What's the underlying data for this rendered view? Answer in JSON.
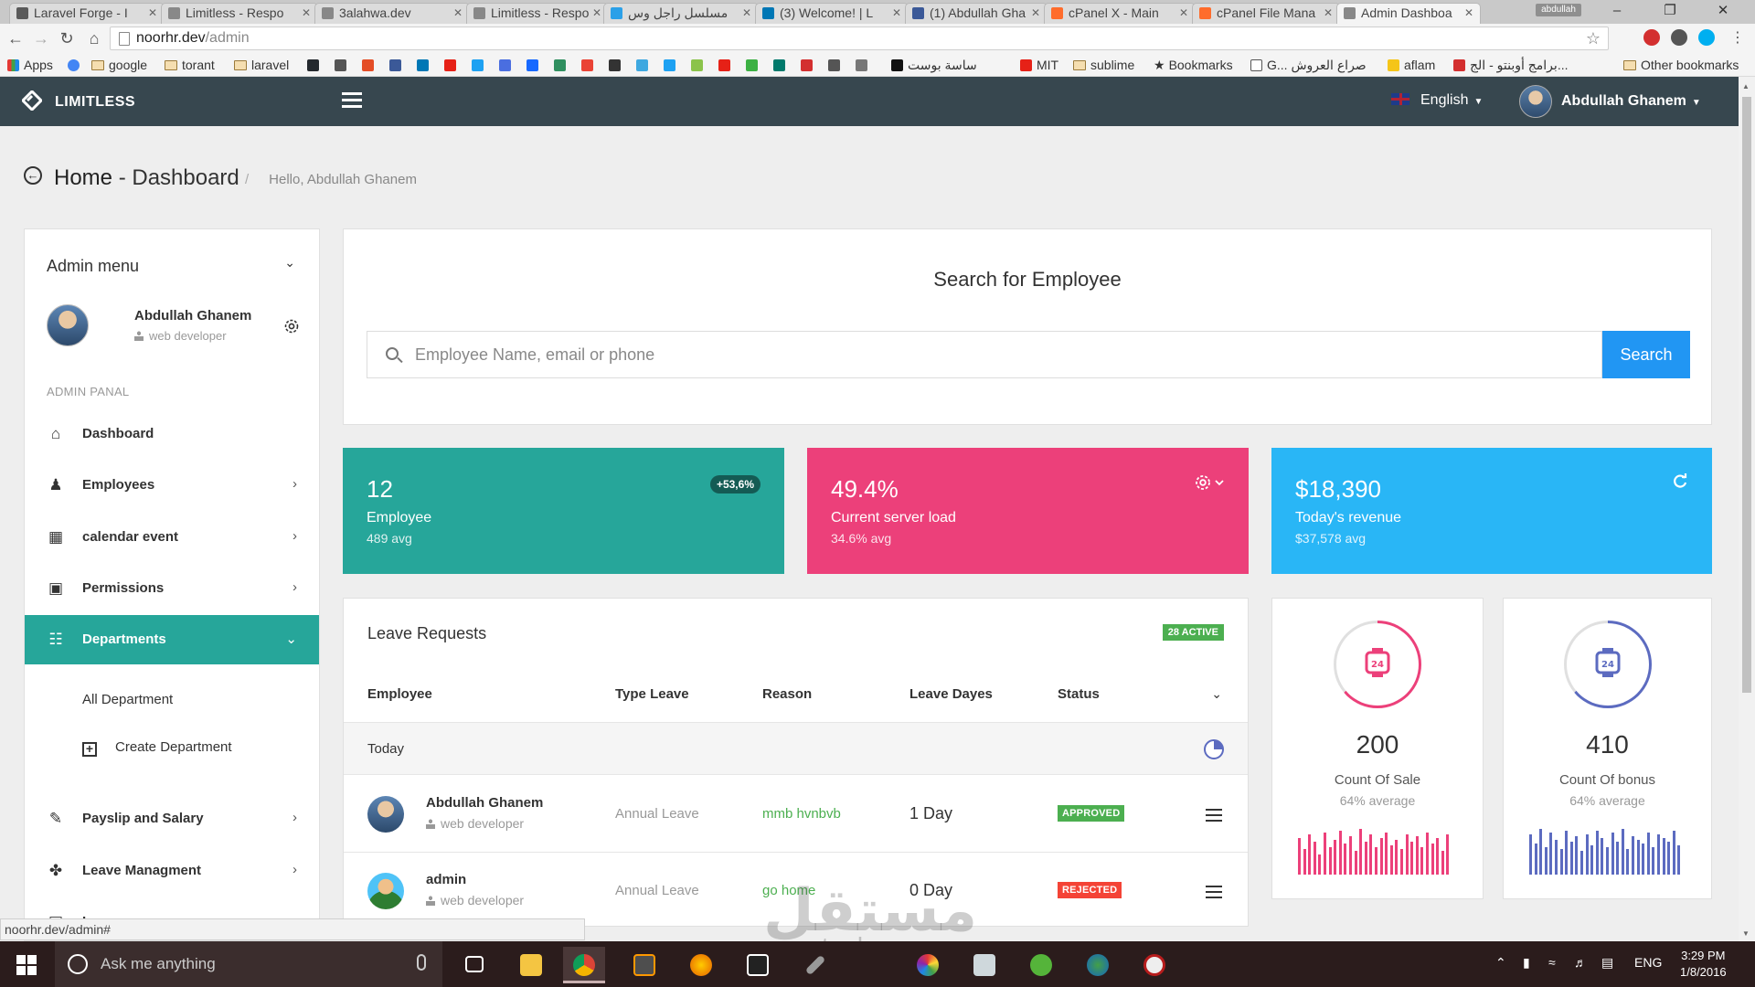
{
  "browser": {
    "tabs": [
      {
        "title": "Laravel Forge - I",
        "favicon_color": "#5a5a5a"
      },
      {
        "title": "Limitless - Respo",
        "favicon_color": "#888888"
      },
      {
        "title": "3alahwa.dev",
        "favicon_color": "#888888"
      },
      {
        "title": "Limitless - Respo",
        "favicon_color": "#888888"
      },
      {
        "title": "مسلسل راجل وس",
        "favicon_color": "#2ba0e8"
      },
      {
        "title": "(3) Welcome! | L",
        "favicon_color": "#0077b5"
      },
      {
        "title": "(1) Abdullah Gha",
        "favicon_color": "#3b5998"
      },
      {
        "title": "cPanel X - Main",
        "favicon_color": "#ff6c2c"
      },
      {
        "title": "cPanel File Mana",
        "favicon_color": "#ff6c2c"
      },
      {
        "title": "Admin Dashboa",
        "favicon_color": "#888888",
        "active": true
      }
    ],
    "profile_chip": "abdullah",
    "url_host": "noorhr.dev",
    "url_path": "/admin",
    "bookmarks": [
      {
        "label": "Apps",
        "kind": "apps"
      },
      {
        "label": "google",
        "kind": "folder"
      },
      {
        "label": "torant",
        "kind": "folder"
      },
      {
        "label": "laravel",
        "kind": "folder"
      },
      {
        "label": "ساسة بوست",
        "kind": "link"
      },
      {
        "label": "MIT",
        "kind": "link"
      },
      {
        "label": "sublime",
        "kind": "folder"
      },
      {
        "label": "Bookmarks",
        "kind": "star"
      },
      {
        "label": "G... صراع العروش",
        "kind": "link"
      },
      {
        "label": "aflam",
        "kind": "link"
      },
      {
        "label": "برامج أوبنتو - الج...",
        "kind": "link"
      },
      {
        "label": "Other bookmarks",
        "kind": "folder"
      }
    ],
    "status_url": "noorhr.dev/admin#"
  },
  "appbar": {
    "brand": "LIMITLESS",
    "language": "English",
    "user_name": "Abdullah Ghanem"
  },
  "page_header": {
    "title_strong": "Home",
    "title_rest": " - Dashboard",
    "greeting": "Hello, Abdullah Ghanem"
  },
  "sidebar": {
    "title": "Admin menu",
    "user_name": "Abdullah Ghanem",
    "user_role": "web developer",
    "section_label": "ADMIN PANAL",
    "items": [
      {
        "label": "Dashboard",
        "icon": "home-icon",
        "has_arrow": false
      },
      {
        "label": "Employees",
        "icon": "user-tie-icon",
        "has_arrow": true
      },
      {
        "label": "calendar event",
        "icon": "calendar-icon",
        "has_arrow": true
      },
      {
        "label": "Permissions",
        "icon": "lock-icon",
        "has_arrow": true
      },
      {
        "label": "Departments",
        "icon": "sitemap-icon",
        "has_arrow": true,
        "active": true
      },
      {
        "label": "Payslip and Salary",
        "icon": "pencil-icon",
        "has_arrow": true
      },
      {
        "label": "Leave Managment",
        "icon": "footsteps-icon",
        "has_arrow": true
      },
      {
        "label": "Loans",
        "icon": "truck-icon",
        "has_arrow": true
      }
    ],
    "submenu": [
      {
        "label": "All Department"
      },
      {
        "label": "Create Department"
      }
    ]
  },
  "search": {
    "title": "Search for Employee",
    "placeholder": "Employee Name, email or phone",
    "button_label": "Search"
  },
  "stats": [
    {
      "value": "12",
      "label": "Employee",
      "sub": "489 avg",
      "badge": "+53,6%",
      "color": "#26a69a"
    },
    {
      "value": "49.4%",
      "label": "Current server load",
      "sub": "34.6% avg",
      "icon": "gear-icon",
      "color": "#ec407a"
    },
    {
      "value": "$18,390",
      "label": "Today's revenue",
      "sub": "$37,578 avg",
      "icon": "refresh-icon",
      "color": "#29b6f6"
    }
  ],
  "leave_requests": {
    "title": "Leave Requests",
    "badge": "28 ACTIVE",
    "columns": [
      "Employee",
      "Type Leave",
      "Reason",
      "Leave Dayes",
      "Status"
    ],
    "group_label": "Today",
    "rows": [
      {
        "name": "Abdullah Ghanem",
        "role": "web developer",
        "type": "Annual Leave",
        "reason": "mmb hvnbvb",
        "days": "1 Day",
        "status": "APPROVED",
        "status_color": "#4caf50"
      },
      {
        "name": "admin",
        "role": "web developer",
        "type": "Annual Leave",
        "reason": "go home",
        "days": "0 Day",
        "status": "REJECTED",
        "status_color": "#f44336"
      }
    ]
  },
  "counters": [
    {
      "value": "200",
      "label": "Count Of Sale",
      "sub": "64% average",
      "color": "#ec407a",
      "progress": 0.64
    },
    {
      "value": "410",
      "label": "Count Of bonus",
      "sub": "64% average",
      "color": "#5c6bc0",
      "progress": 0.64
    }
  ],
  "watermark": {
    "text": "مستقل",
    "sub": "mostaql.com"
  },
  "taskbar": {
    "search_placeholder": "Ask me anything",
    "time": "3:29 PM",
    "date": "1/8/2016",
    "lang": "ENG"
  }
}
